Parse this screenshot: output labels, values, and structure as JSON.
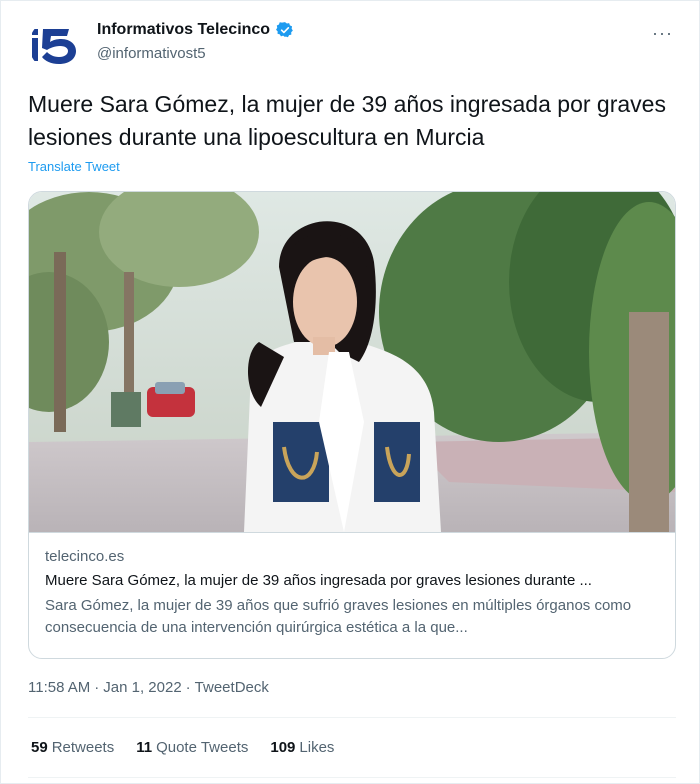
{
  "account": {
    "display_name": "Informativos Telecinco",
    "handle": "@informativost5",
    "logo_text": "i5",
    "verified": true
  },
  "tweet": {
    "text": "Muere Sara Gómez, la mujer de 39 años ingresada por graves lesiones durante una lipoescultura en Murcia",
    "translate_label": "Translate Tweet",
    "time": "11:58 AM",
    "date": "Jan 1, 2022",
    "source": "TweetDeck",
    "separator": "·"
  },
  "card": {
    "domain": "telecinco.es",
    "title": "Muere Sara Gómez, la mujer de 39 años ingresada por graves lesiones durante ...",
    "description": "Sara Gómez, la mujer de 39 años que sufrió graves lesiones en múltiples órganos como consecuencia de una intervención quirúrgica estética a la que..."
  },
  "stats": {
    "retweets_count": "59",
    "retweets_label": "Retweets",
    "quotes_count": "11",
    "quotes_label": "Quote Tweets",
    "likes_count": "109",
    "likes_label": "Likes"
  },
  "menu": {
    "more_label": "···"
  },
  "colors": {
    "accent": "#1d9bf0",
    "text": "#0f1419",
    "muted": "#536471",
    "brand_blue": "#1c3f94"
  }
}
